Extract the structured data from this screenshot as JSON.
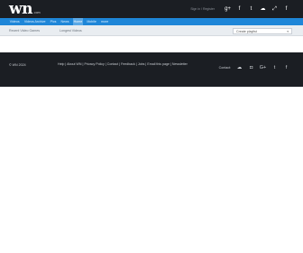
{
  "header": {
    "logo_text": "wn",
    "logo_suffix": ".com",
    "signin_text": "Sign in / Register",
    "social_icons": [
      "google-plus-icon",
      "facebook-icon",
      "twitter-icon",
      "chat-icon",
      "share-icon",
      "facebook-icon"
    ],
    "social_glyphs": [
      "g+",
      "f",
      "t",
      "☁",
      "⤢",
      "f"
    ]
  },
  "nav": {
    "items": [
      {
        "label": "Videos",
        "active": false
      },
      {
        "label": "Videos Archive",
        "active": false
      },
      {
        "label": "Pics",
        "active": false
      },
      {
        "label": "News",
        "active": false
      },
      {
        "label": "Home",
        "active": true
      },
      {
        "label": "Mobile",
        "active": false
      },
      {
        "label": "more",
        "active": false
      }
    ]
  },
  "subbar": {
    "tab_recent": "Recent Video Games",
    "tab_longest": "Longest Videos",
    "playlist_label": "Create playlist",
    "playlist_arrow": "▾"
  },
  "footer": {
    "copyright": "© WN 2024",
    "links": [
      "Help",
      "About WN",
      "Privacy Policy",
      "Contact",
      "Feedback",
      "Jobs",
      "Email this page",
      "Newsletter"
    ],
    "contact_label": "Contact:",
    "contact_icons": [
      "chat-icon",
      "instagram-icon",
      "google-plus-icon",
      "twitter-icon",
      "facebook-icon"
    ],
    "contact_glyphs": [
      "☁",
      "◘",
      "G+",
      "t",
      "f"
    ]
  },
  "colors": {
    "topbar": "#1b1e23",
    "nav": "#1e86d8",
    "nav_active": "#5aa8e6",
    "subbar": "#e9edf1",
    "footer": "#1b1e23"
  }
}
